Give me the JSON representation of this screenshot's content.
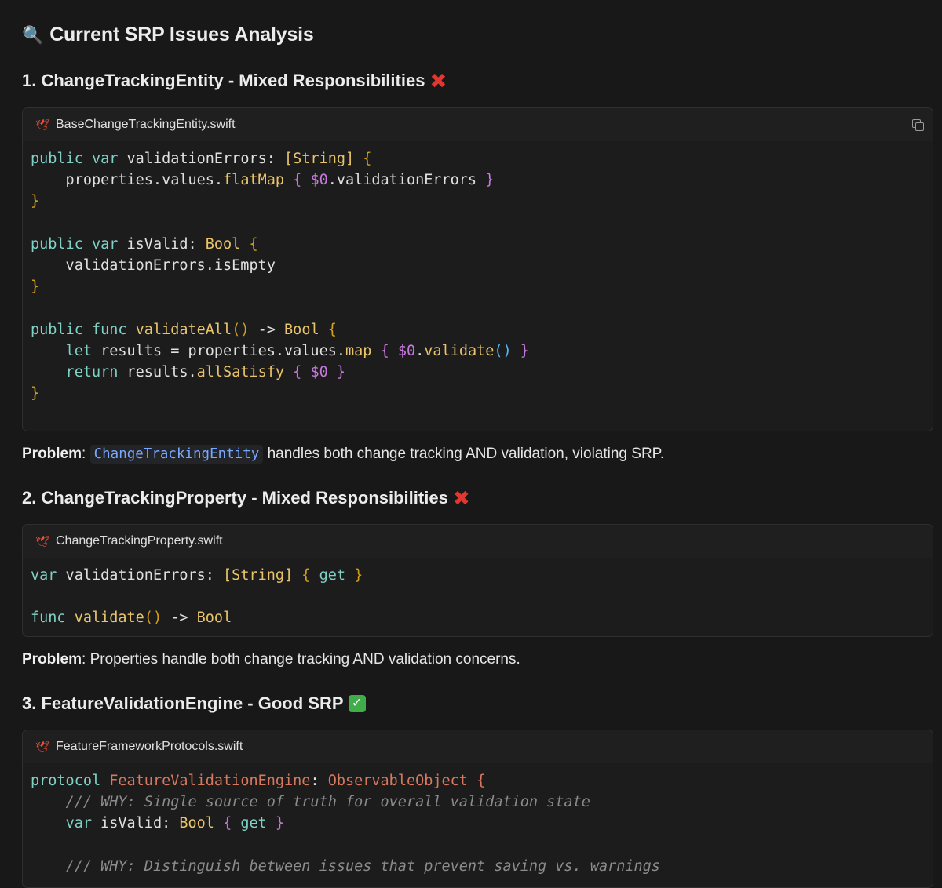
{
  "title": {
    "icon": "magnifying-glass-icon",
    "text": "Current SRP Issues Analysis"
  },
  "sections": [
    {
      "heading": "1. ChangeTrackingEntity - Mixed Responsibilities",
      "status_icon": "cross-mark-icon",
      "file": "BaseChangeTrackingEntity.swift",
      "problem_label": "Problem",
      "problem_code": "ChangeTrackingEntity",
      "problem_text": " handles both change tracking AND validation, violating SRP."
    },
    {
      "heading": "2. ChangeTrackingProperty - Mixed Responsibilities",
      "status_icon": "cross-mark-icon",
      "file": "ChangeTrackingProperty.swift",
      "problem_label": "Problem",
      "problem_text": ": Properties handle both change tracking AND validation concerns."
    },
    {
      "heading": "3. FeatureValidationEngine - Good SRP",
      "status_icon": "check-mark-icon",
      "file": "FeatureFrameworkProtocols.swift"
    }
  ],
  "colors": {
    "background": "#181818",
    "keyword": "#7fd1c5",
    "type": "#e9c46a",
    "comment": "#8b8b8b",
    "protocol_name": "#d8785e",
    "inline_code": "#79a8ff",
    "cross": "#e0372f",
    "check": "#3fae4a"
  }
}
